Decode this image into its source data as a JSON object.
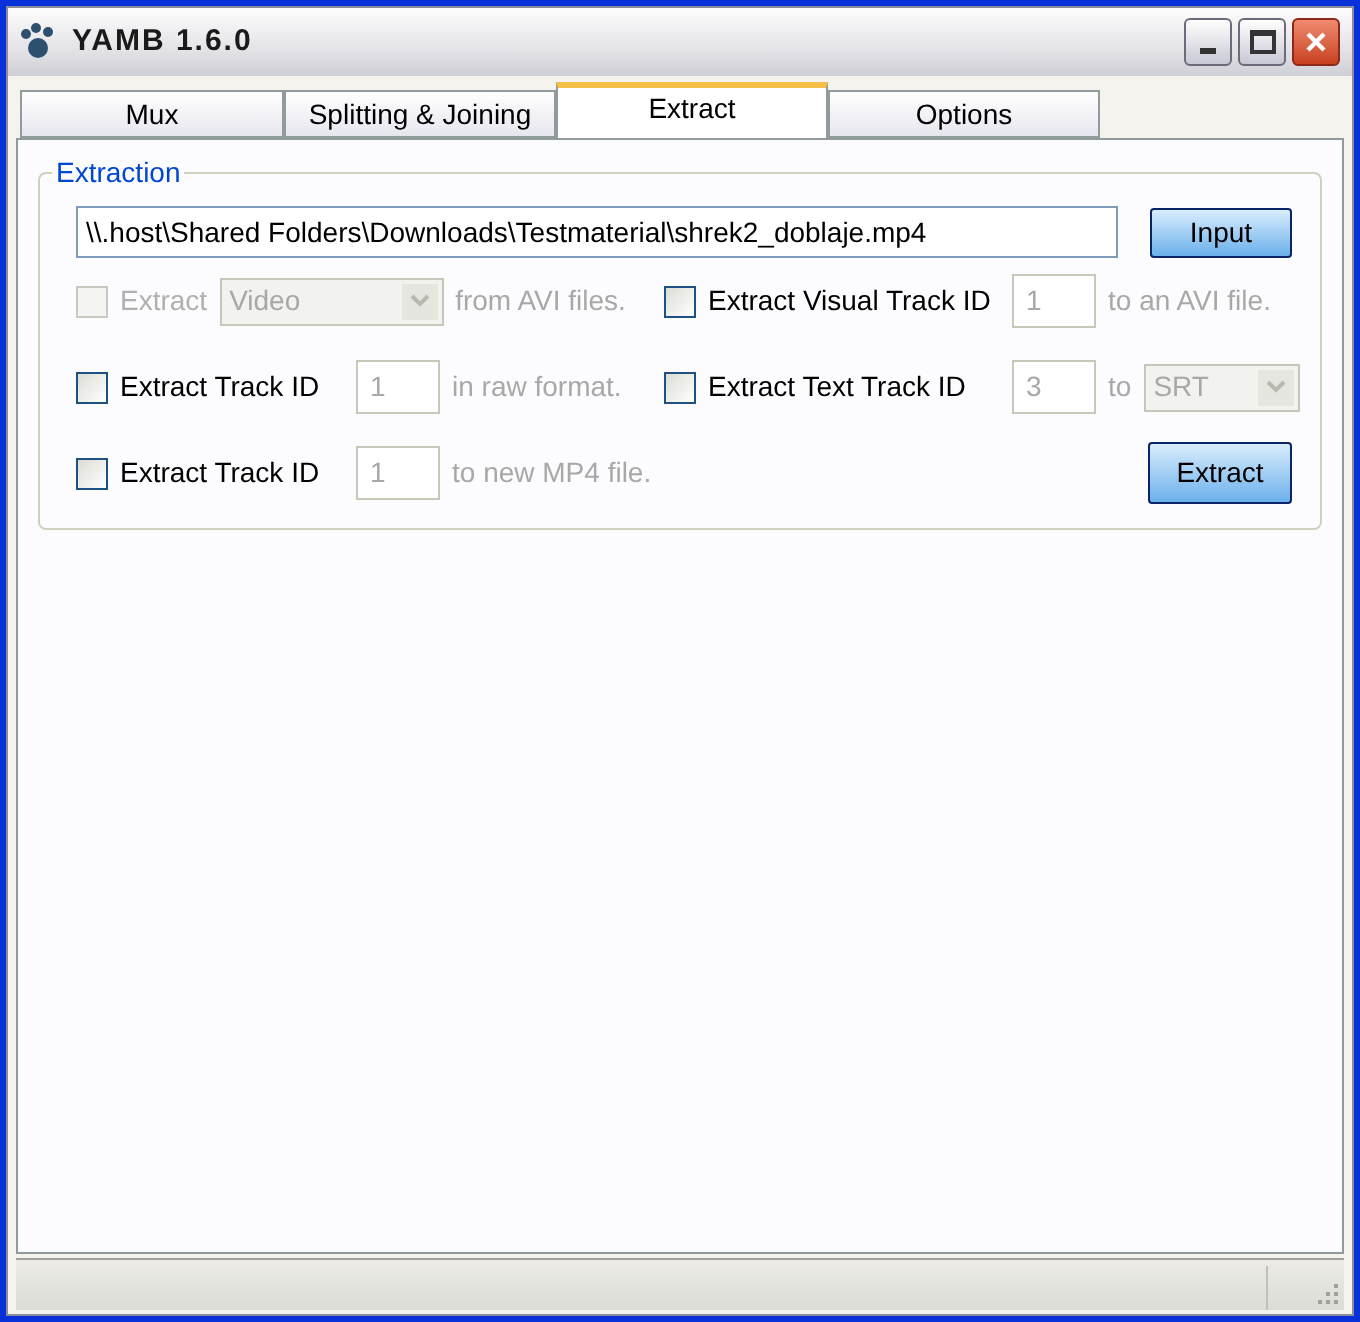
{
  "window": {
    "title": "YAMB 1.6.0"
  },
  "tabs": [
    {
      "label": "Mux",
      "selected": false
    },
    {
      "label": "Splitting & Joining",
      "selected": false
    },
    {
      "label": "Extract",
      "selected": true
    },
    {
      "label": "Options",
      "selected": false
    }
  ],
  "extraction": {
    "legend": "Extraction",
    "path_value": "\\\\.host\\Shared Folders\\Downloads\\Testmaterial\\shrek2_doblaje.mp4",
    "input_button": "Input",
    "rows": [
      {
        "left": {
          "label": "Extract",
          "checked": false,
          "disabled": true,
          "parts": [
            {
              "kind": "dropdown",
              "value": "Video"
            },
            {
              "kind": "label",
              "text": "from AVI files."
            }
          ]
        },
        "right": {
          "kind": "option",
          "label": "Extract Visual Track ID",
          "checked": false,
          "disabled": false,
          "parts": [
            {
              "kind": "field",
              "value": "1"
            },
            {
              "kind": "label",
              "text": "to an AVI file."
            }
          ]
        }
      },
      {
        "left": {
          "label": "Extract Track ID",
          "checked": false,
          "disabled": false,
          "parts": [
            {
              "kind": "field",
              "value": "1"
            },
            {
              "kind": "label",
              "text": "in raw format."
            }
          ]
        },
        "right": {
          "kind": "option",
          "label": "Extract Text Track ID",
          "checked": false,
          "disabled": false,
          "parts": [
            {
              "kind": "field",
              "value": "3"
            },
            {
              "kind": "label",
              "text": "to"
            },
            {
              "kind": "dropdown",
              "value": "SRT"
            }
          ]
        }
      },
      {
        "left": {
          "label": "Extract Track ID",
          "checked": false,
          "disabled": false,
          "parts": [
            {
              "kind": "field",
              "value": "1"
            },
            {
              "kind": "label",
              "text": "to new MP4 file."
            }
          ]
        },
        "right": {
          "kind": "button",
          "label": "Extract"
        }
      }
    ]
  }
}
